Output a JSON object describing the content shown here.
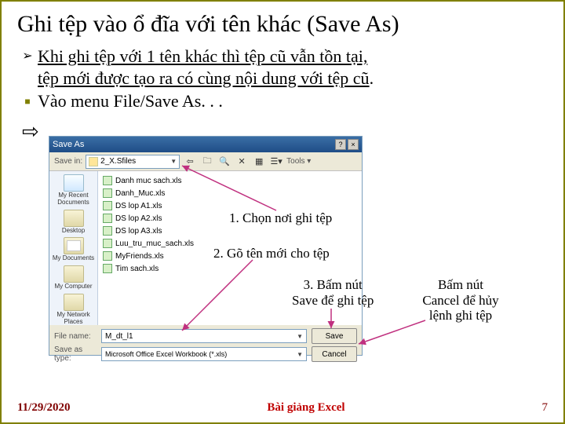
{
  "title": "Ghi tệp vào ổ đĩa với tên khác (Save As)",
  "bullets": {
    "b1_span1": "Khi ghi tệp với 1 tên khác thì tệp cũ vẫn tồn tại,",
    "b1_span2": " tệp mới được tạo ra có cùng nội dung với tệp cũ",
    "b1_dot": ".",
    "b2": "Vào menu File/Save As. . ."
  },
  "dialog": {
    "caption": "Save As",
    "help": "?",
    "close": "×",
    "save_in_label": "Save in:",
    "save_in_value": "2_X.Sfiles",
    "tools_label": "Tools",
    "places": {
      "recent": "My Recent Documents",
      "desktop": "Desktop",
      "mydocs": "My Documents",
      "mycomp": "My Computer",
      "mynet": "My Network Places"
    },
    "files": [
      "Danh muc sach.xls",
      "Danh_Muc.xls",
      "DS lop A1.xls",
      "DS lop A2.xls",
      "DS lop A3.xls",
      "Luu_tru_muc_sach.xls",
      "MyFriends.xls",
      "Tim sach.xls"
    ],
    "filename_label": "File name:",
    "filename_value": "M_dt_l1",
    "filetype_label": "Save as type:",
    "filetype_value": "Microsoft Office Excel Workbook (*.xls)",
    "save_btn": "Save",
    "cancel_btn": "Cancel"
  },
  "annotations": {
    "a1": "1. Chọn nơi ghi tệp",
    "a2": "2. Gõ tên mới cho tệp",
    "a3_l1": "3. Bấm nút",
    "a3_l2": "Save để ghi tệp",
    "a4_l1": "Bấm nút",
    "a4_l2": "Cancel để hủy",
    "a4_l3": "lệnh ghi tệp"
  },
  "footer": {
    "date": "11/29/2020",
    "mid": "Bài giảng Excel",
    "page": "7"
  }
}
